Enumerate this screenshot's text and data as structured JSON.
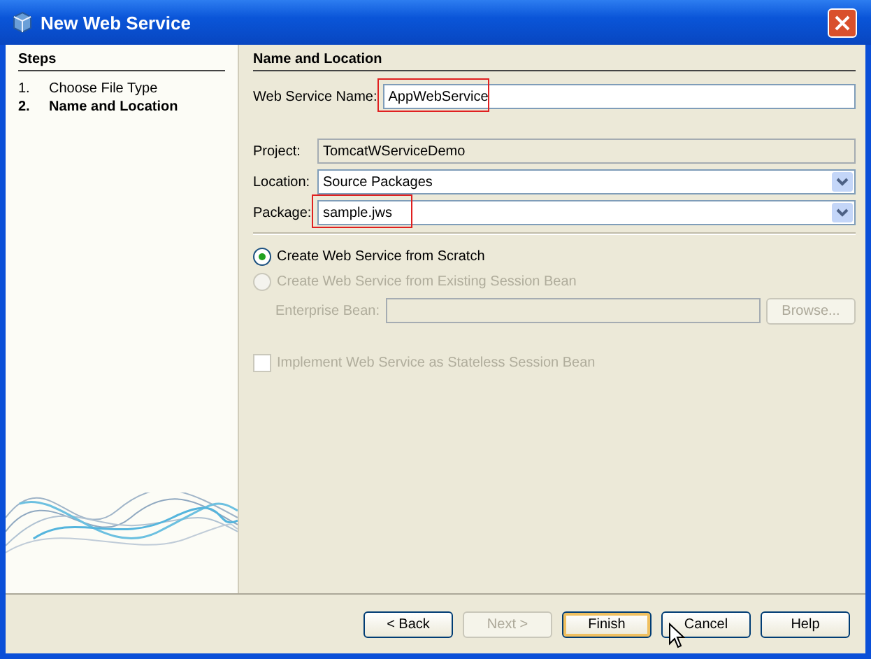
{
  "window": {
    "title": "New Web Service"
  },
  "steps": {
    "title": "Steps",
    "items": [
      {
        "number": "1.",
        "label": "Choose File Type",
        "selected": false
      },
      {
        "number": "2.",
        "label": "Name and Location",
        "selected": true
      }
    ]
  },
  "panel": {
    "title": "Name and Location"
  },
  "fields": [
    {
      "kind": "text",
      "label": "Web Service Name:",
      "value": "AppWebService",
      "highlighted": true
    },
    {
      "kind": "readonly",
      "label": "Project:",
      "value": "TomcatWServiceDemo",
      "highlighted": false
    },
    {
      "kind": "combo",
      "label": "Location:",
      "value": "Source Packages",
      "highlighted": false
    },
    {
      "kind": "combo",
      "label": "Package:",
      "value": "sample.jws",
      "highlighted": true
    }
  ],
  "options": [
    {
      "label": "Create Web Service from Scratch",
      "selected": true,
      "disabled": false
    },
    {
      "label": "Create Web Service from Existing Session Bean",
      "selected": false,
      "disabled": true
    }
  ],
  "enterprise_bean": {
    "label": "Enterprise Bean:",
    "disabled": true,
    "button": "Browse..."
  },
  "stateless": {
    "label": "Implement Web Service as Stateless Session Bean",
    "checked": false,
    "disabled": true
  },
  "buttons": [
    {
      "label": "< Back",
      "disabled": false,
      "default": false
    },
    {
      "label": "Next >",
      "disabled": true,
      "default": false
    },
    {
      "label": "Finish",
      "disabled": false,
      "default": true
    },
    {
      "label": "Cancel",
      "disabled": false,
      "default": false
    },
    {
      "label": "Help",
      "disabled": false,
      "default": false
    }
  ]
}
